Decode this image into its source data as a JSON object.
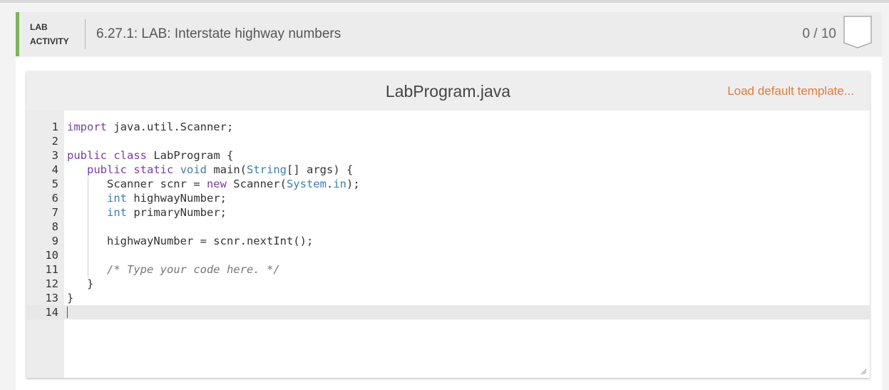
{
  "lab": {
    "tag_line1": "LAB",
    "tag_line2": "ACTIVITY",
    "title": "6.27.1: LAB: Interstate highway numbers",
    "score": "0 / 10",
    "accent_color": "#7ab55c"
  },
  "editor": {
    "file_name": "LabProgram.java",
    "load_template_label": "Load default template...",
    "link_color": "#e07b3c",
    "lines": [
      {
        "n": "1",
        "tokens": [
          {
            "t": "kw",
            "v": "import"
          },
          {
            "t": "",
            "v": " java.util.Scanner;"
          }
        ]
      },
      {
        "n": "2",
        "tokens": []
      },
      {
        "n": "3",
        "tokens": [
          {
            "t": "kw",
            "v": "public"
          },
          {
            "t": "",
            "v": " "
          },
          {
            "t": "kw",
            "v": "class"
          },
          {
            "t": "",
            "v": " LabProgram {"
          }
        ]
      },
      {
        "n": "4",
        "tokens": [
          {
            "t": "",
            "v": "   "
          },
          {
            "t": "kw",
            "v": "public"
          },
          {
            "t": "",
            "v": " "
          },
          {
            "t": "kw",
            "v": "static"
          },
          {
            "t": "",
            "v": " "
          },
          {
            "t": "ty",
            "v": "void"
          },
          {
            "t": "",
            "v": " main("
          },
          {
            "t": "ty",
            "v": "String"
          },
          {
            "t": "",
            "v": "[] args) {"
          }
        ]
      },
      {
        "n": "5",
        "tokens": [
          {
            "t": "",
            "v": "      Scanner scnr = "
          },
          {
            "t": "kw",
            "v": "new"
          },
          {
            "t": "",
            "v": " Scanner("
          },
          {
            "t": "ty",
            "v": "System"
          },
          {
            "t": "",
            "v": "."
          },
          {
            "t": "ty",
            "v": "in"
          },
          {
            "t": "",
            "v": ");"
          }
        ]
      },
      {
        "n": "6",
        "tokens": [
          {
            "t": "",
            "v": "      "
          },
          {
            "t": "ty",
            "v": "int"
          },
          {
            "t": "",
            "v": " highwayNumber;"
          }
        ]
      },
      {
        "n": "7",
        "tokens": [
          {
            "t": "",
            "v": "      "
          },
          {
            "t": "ty",
            "v": "int"
          },
          {
            "t": "",
            "v": " primaryNumber;"
          }
        ]
      },
      {
        "n": "8",
        "tokens": []
      },
      {
        "n": "9",
        "tokens": [
          {
            "t": "",
            "v": "      highwayNumber = scnr.nextInt();"
          }
        ]
      },
      {
        "n": "10",
        "tokens": []
      },
      {
        "n": "11",
        "tokens": [
          {
            "t": "",
            "v": "      "
          },
          {
            "t": "cm",
            "v": "/* Type your code here. */"
          }
        ]
      },
      {
        "n": "12",
        "tokens": [
          {
            "t": "",
            "v": "   }"
          }
        ]
      },
      {
        "n": "13",
        "tokens": [
          {
            "t": "",
            "v": "}"
          }
        ]
      },
      {
        "n": "14",
        "tokens": [],
        "active": true
      }
    ]
  }
}
